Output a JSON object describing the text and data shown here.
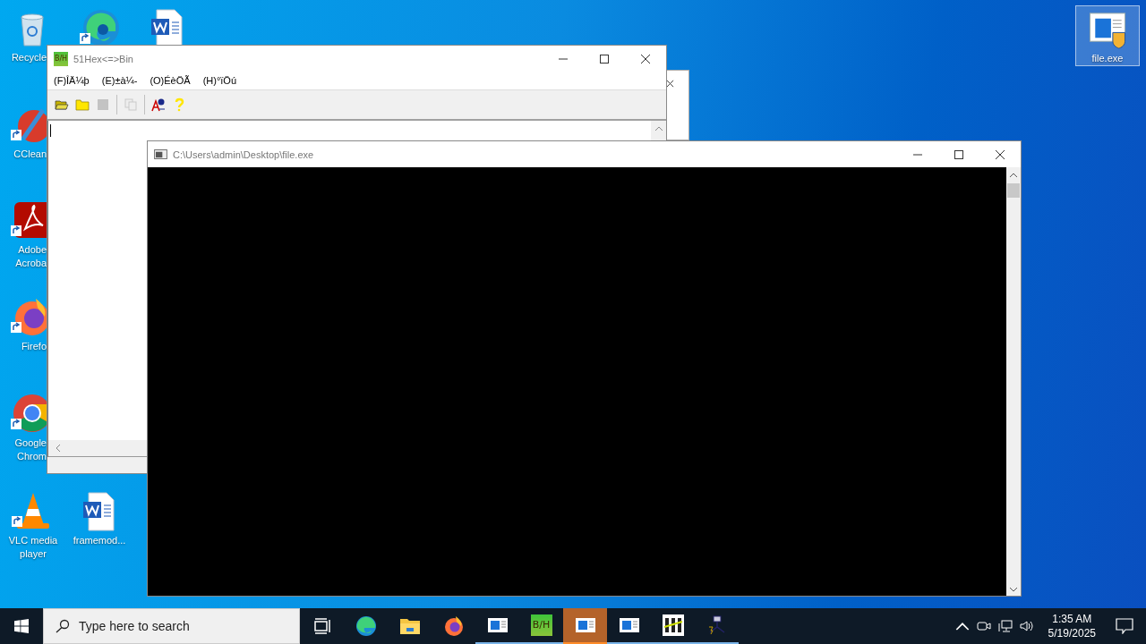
{
  "desktop": {
    "icons": [
      {
        "label": "Recycle",
        "kind": "recycle",
        "shortcut": false,
        "selected": false
      },
      {
        "kind": "edge",
        "shortcut": true,
        "selected": false
      },
      {
        "kind": "word",
        "shortcut": false,
        "selected": false
      },
      {
        "label": "CClean",
        "kind": "ccleaner",
        "shortcut": true,
        "selected": false
      },
      {
        "label": "Adobe Acroba",
        "kind": "acrobat",
        "shortcut": true,
        "selected": false
      },
      {
        "label": "Firefo",
        "kind": "firefox",
        "shortcut": true,
        "selected": false
      },
      {
        "label": "Google Chrom",
        "kind": "chrome",
        "shortcut": true,
        "selected": false
      },
      {
        "label": "VLC media player",
        "kind": "vlc",
        "shortcut": true,
        "selected": false
      },
      {
        "label": "framemod...",
        "kind": "word",
        "shortcut": false,
        "selected": false
      },
      {
        "label": "file.exe",
        "kind": "exe",
        "shortcut": false,
        "selected": true
      }
    ]
  },
  "hex_window": {
    "logo": "B/H",
    "title": "51Hex<=>Bin",
    "menu": [
      "(F)ÎÄ¼þ",
      "(E)±à¼-",
      "(O)ÉèÖÃ",
      "(H)°ïÖú"
    ],
    "toolbar": [
      {
        "kind": "open",
        "disabled": false
      },
      {
        "kind": "folder",
        "disabled": false
      },
      {
        "kind": "stop",
        "disabled": true
      },
      {
        "kind": "separator"
      },
      {
        "kind": "copy",
        "disabled": true
      },
      {
        "kind": "separator"
      },
      {
        "kind": "font",
        "disabled": false
      },
      {
        "kind": "help",
        "disabled": false
      }
    ]
  },
  "console_window": {
    "title": "C:\\Users\\admin\\Desktop\\file.exe"
  },
  "taskbar": {
    "search": {
      "placeholder": "Type here to search"
    },
    "apps": [
      {
        "kind": "taskview",
        "running": false,
        "selected": false
      },
      {
        "kind": "edge",
        "running": false,
        "selected": false
      },
      {
        "kind": "explorer",
        "running": false,
        "selected": false
      },
      {
        "kind": "firefox",
        "running": false,
        "selected": false
      },
      {
        "kind": "window",
        "running": true,
        "selected": false
      },
      {
        "kind": "hex",
        "logo": "B/H",
        "running": true,
        "selected": false
      },
      {
        "kind": "window",
        "running": true,
        "selected": true
      },
      {
        "kind": "window",
        "running": true,
        "selected": false
      },
      {
        "kind": "bars",
        "running": true,
        "selected": false
      },
      {
        "kind": "tool",
        "running": true,
        "selected": false
      }
    ],
    "clock": {
      "time": "1:35 AM",
      "date": "5/19/2025"
    }
  }
}
